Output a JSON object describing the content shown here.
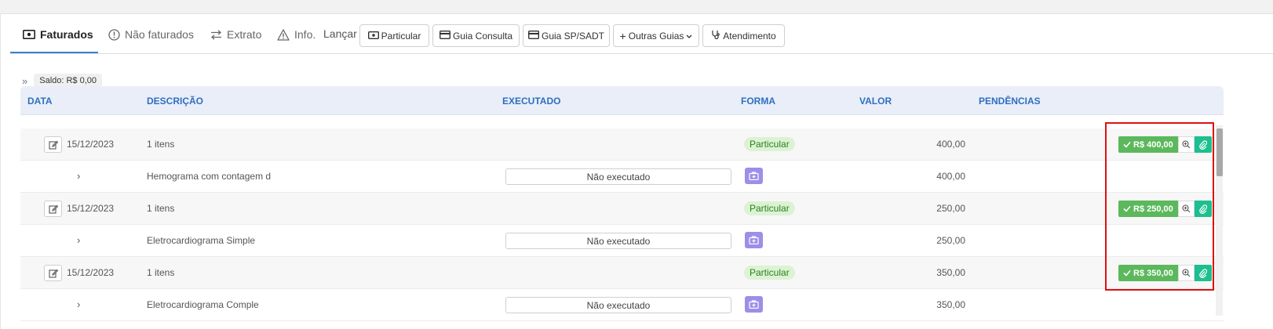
{
  "tabs": [
    {
      "label": "Faturados",
      "icon": "money-icon"
    },
    {
      "label": "Não faturados",
      "icon": "alert-circle-icon"
    },
    {
      "label": "Extrato",
      "icon": "swap-arrows-icon"
    },
    {
      "label": "Info.",
      "icon": "warning-triangle-icon"
    }
  ],
  "launch_label": "Lançar",
  "buttons": {
    "particular": "Particular",
    "guia_consulta": "Guia Consulta",
    "guia_sp_sadt": "Guia SP/SADT",
    "outras_guias": "Outras Guias",
    "atendimento": "Atendimento"
  },
  "saldo": "Saldo: R$ 0,00",
  "columns": [
    "DATA",
    "DESCRIÇÃO",
    "EXECUTADO",
    "FORMA",
    "VALOR",
    "PENDÊNCIAS"
  ],
  "rows": [
    {
      "date": "15/12/2023",
      "description": "1 itens",
      "forma": "Particular",
      "valor": "400,00",
      "pay_label": "R$ 400,00",
      "item": {
        "description": "Hemograma com contagem d",
        "executado": "Não executado",
        "valor": "400,00"
      }
    },
    {
      "date": "15/12/2023",
      "description": "1 itens",
      "forma": "Particular",
      "valor": "250,00",
      "pay_label": "R$ 250,00",
      "item": {
        "description": "Eletrocardiograma Simple",
        "executado": "Não executado",
        "valor": "250,00"
      }
    },
    {
      "date": "15/12/2023",
      "description": "1 itens",
      "forma": "Particular",
      "valor": "350,00",
      "pay_label": "R$ 350,00",
      "item": {
        "description": "Eletrocardiograma Comple",
        "executado": "Não executado",
        "valor": "350,00"
      }
    }
  ]
}
